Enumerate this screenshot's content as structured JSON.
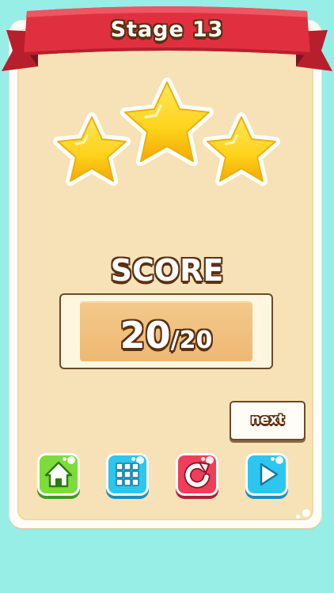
{
  "header": {
    "title_word": "Stage",
    "title_number": "13"
  },
  "stars": {
    "earned": 3,
    "total": 3
  },
  "score": {
    "label": "SCORE",
    "value": "20",
    "separator": "/",
    "max": "20"
  },
  "buttons": {
    "next_label": "next",
    "home_icon": "home-icon",
    "levels_icon": "grid-icon",
    "replay_icon": "replay-icon",
    "play_icon": "play-icon"
  },
  "colors": {
    "background": "#96eee6",
    "ribbon": "#e03040",
    "star": "#ffd21a",
    "home_button": "#7ddc3a",
    "grid_button": "#2cc6ef",
    "replay_button": "#ef3e5a",
    "play_button": "#2cc6ef"
  }
}
